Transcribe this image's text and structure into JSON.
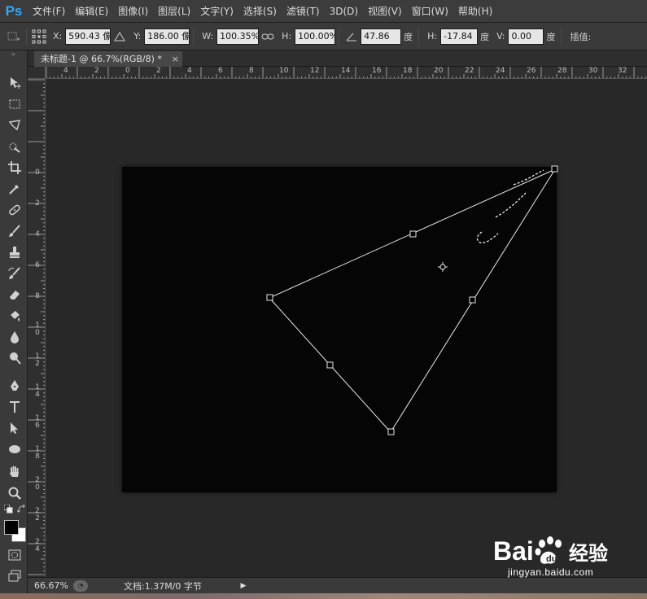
{
  "app": {
    "logo": "Ps"
  },
  "menu": [
    "文件(F)",
    "编辑(E)",
    "图像(I)",
    "图层(L)",
    "文字(Y)",
    "选择(S)",
    "滤镜(T)",
    "3D(D)",
    "视图(V)",
    "窗口(W)",
    "帮助(H)"
  ],
  "options": {
    "x_label": "X:",
    "x_value": "590.43 像",
    "y_label": "Y:",
    "y_value": "186.00 像",
    "w_label": "W:",
    "w_value": "100.35%",
    "h_label": "H:",
    "h_value": "100.00%",
    "angle_value": "47.86",
    "angle_unit": "度",
    "hskew_label": "H:",
    "hskew_value": "-17.84",
    "hskew_unit": "度",
    "vskew_label": "V:",
    "vskew_value": "0.00",
    "vskew_unit": "度",
    "interp_label": "插值:"
  },
  "document": {
    "tab_title": "未标题-1 @ 66.7%(RGB/8) *",
    "close_glyph": "×"
  },
  "ruler": {
    "top_labels": [
      "4",
      "2",
      "0",
      "2",
      "4",
      "6",
      "8",
      "10",
      "12",
      "14",
      "16",
      "18",
      "20",
      "22",
      "24",
      "26",
      "28",
      "30",
      "32"
    ],
    "left_labels": [
      "0",
      "2",
      "4",
      "6",
      "8",
      "10",
      "12",
      "14",
      "16",
      "18",
      "20",
      "22",
      "24"
    ]
  },
  "status": {
    "zoom": "66.67%",
    "doc_info": "文档:1.37M/0 字节"
  },
  "watermark": {
    "brand": "Baidu经验",
    "url": "jingyan.baidu.com"
  },
  "colors": {
    "accent": "#31a8ff",
    "canvas": "#050505",
    "workspace": "#282828",
    "path_line": "#e8e8e8"
  },
  "toolbar_tools": [
    "move-icon",
    "marquee-icon",
    "lasso-icon",
    "quick-select-icon",
    "crop-icon",
    "eyedropper-icon",
    "healing-icon",
    "brush-icon",
    "stamp-icon",
    "history-brush-icon",
    "eraser-icon",
    "gradient-icon",
    "blur-icon",
    "dodge-icon",
    "pen-icon",
    "type-icon",
    "path-select-icon",
    "ellipse-icon",
    "hand-icon",
    "zoom-icon",
    "swap-colors-icon",
    "foreground-background-colors",
    "quick-mask-icon",
    "screen-mode-icon"
  ]
}
